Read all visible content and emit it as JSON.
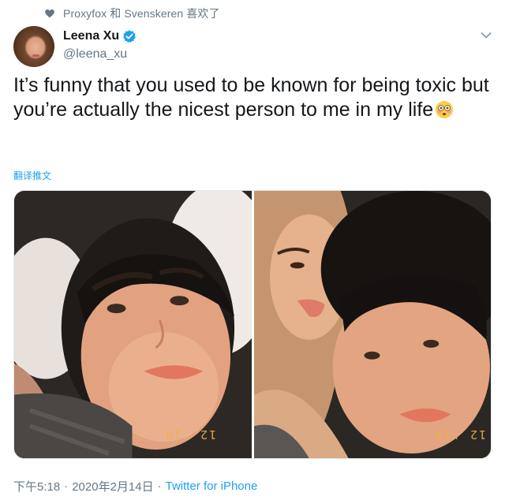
{
  "social_context": {
    "text": "Proxyfox 和 Svenskeren 喜欢了",
    "icon": "heart-icon"
  },
  "author": {
    "display_name": "Leena Xu",
    "handle": "@leena_xu",
    "verified": true,
    "verified_color": "#1da1f2"
  },
  "tweet": {
    "text": "It’s funny that you used to be known for being toxic but you’re actually the nicest person to me in my life",
    "emoji": "flushed-face-emoji",
    "translate_label": "翻译推文"
  },
  "media": {
    "photo_count": 2,
    "left_stamp": "12 '19",
    "right_stamp": "12 '19"
  },
  "meta": {
    "time": "下午5:18",
    "separator": "·",
    "date": "2020年2月14日",
    "separator2": "·",
    "source": "Twitter for iPhone"
  },
  "colors": {
    "accent": "#1da1f2",
    "secondary_text": "#657786",
    "primary_text": "#14171a"
  }
}
